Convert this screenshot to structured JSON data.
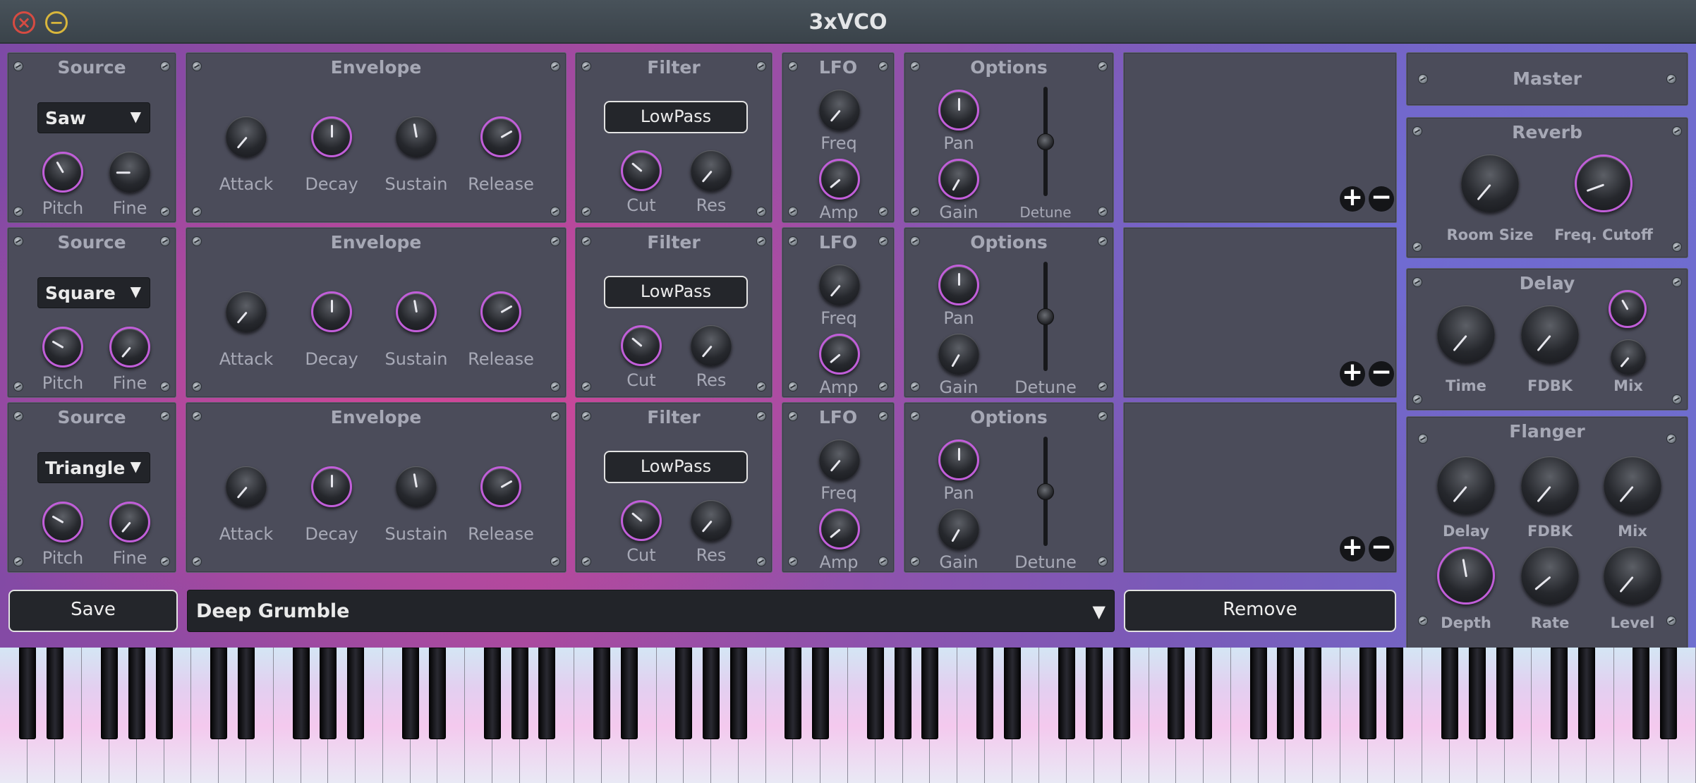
{
  "window": {
    "title": "3xVCO",
    "close_glyph": "⊗",
    "minimize_glyph": "⊖"
  },
  "voices": [
    {
      "source": {
        "title": "Source",
        "waveform": "Saw",
        "knobs": [
          "Pitch",
          "Fine"
        ]
      },
      "envelope": {
        "title": "Envelope",
        "knobs": [
          "Attack",
          "Decay",
          "Sustain",
          "Release"
        ]
      },
      "filter": {
        "title": "Filter",
        "type": "LowPass",
        "knobs": [
          "Cut",
          "Res"
        ]
      },
      "lfo": {
        "title": "LFO",
        "knobs": [
          "Freq",
          "Amp"
        ]
      },
      "options": {
        "title": "Options",
        "knobs": [
          "Pan",
          "Gain"
        ],
        "slider": "Detune"
      }
    },
    {
      "source": {
        "title": "Source",
        "waveform": "Square",
        "knobs": [
          "Pitch",
          "Fine"
        ]
      },
      "envelope": {
        "title": "Envelope",
        "knobs": [
          "Attack",
          "Decay",
          "Sustain",
          "Release"
        ]
      },
      "filter": {
        "title": "Filter",
        "type": "LowPass",
        "knobs": [
          "Cut",
          "Res"
        ]
      },
      "lfo": {
        "title": "LFO",
        "knobs": [
          "Freq",
          "Amp"
        ]
      },
      "options": {
        "title": "Options",
        "knobs": [
          "Pan",
          "Gain"
        ],
        "slider": "Detune"
      }
    },
    {
      "source": {
        "title": "Source",
        "waveform": "Triangle",
        "knobs": [
          "Pitch",
          "Fine"
        ]
      },
      "envelope": {
        "title": "Envelope",
        "knobs": [
          "Attack",
          "Decay",
          "Sustain",
          "Release"
        ]
      },
      "filter": {
        "title": "Filter",
        "type": "LowPass",
        "knobs": [
          "Cut",
          "Res"
        ]
      },
      "lfo": {
        "title": "LFO",
        "knobs": [
          "Freq",
          "Amp"
        ]
      },
      "options": {
        "title": "Options",
        "knobs": [
          "Pan",
          "Gain"
        ],
        "slider": "Detune"
      }
    }
  ],
  "row_buttons": {
    "add": "+",
    "remove": "−"
  },
  "effects": {
    "master": {
      "title": "Master"
    },
    "reverb": {
      "title": "Reverb",
      "knobs": [
        "Room Size",
        "Freq. Cutoff"
      ]
    },
    "delay": {
      "title": "Delay",
      "knobs": [
        "Time",
        "FDBK",
        "Mix"
      ]
    },
    "flanger": {
      "title": "Flanger",
      "knobs": [
        "Delay",
        "FDBK",
        "Mix",
        "Depth",
        "Rate",
        "Level"
      ]
    }
  },
  "preset_bar": {
    "save_label": "Save",
    "preset_name": "Deep Grumble",
    "preset_arrow": "▼",
    "remove_label": "Remove"
  },
  "colors": {
    "accent_ring": "#c15ed9",
    "panel": "#4b4c5a",
    "gradient_pink": "#d846a0",
    "gradient_blue": "#6e6fcf"
  }
}
